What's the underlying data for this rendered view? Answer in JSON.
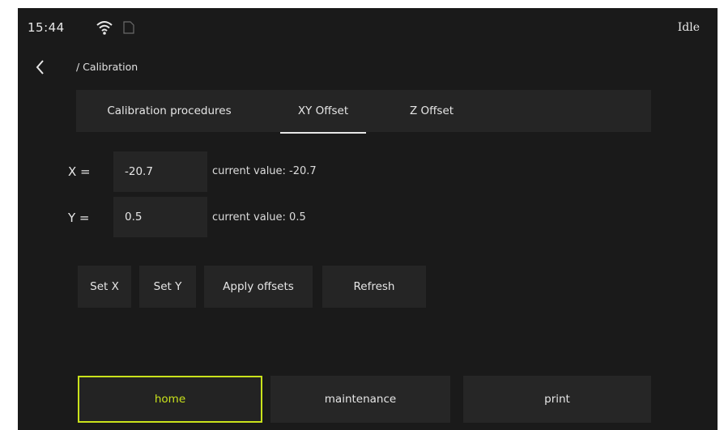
{
  "status_bar": {
    "time": "15:44",
    "wifi_icon": "wifi-icon",
    "sd_icon": "sd-card-icon",
    "state": "Idle"
  },
  "header": {
    "back_icon": "chevron-left-icon",
    "breadcrumb": "/ Calibration"
  },
  "tabs": [
    {
      "label": "Calibration procedures",
      "active": false
    },
    {
      "label": "XY Offset",
      "active": true
    },
    {
      "label": "Z Offset",
      "active": false
    }
  ],
  "offsets": {
    "x": {
      "label": "X =",
      "value": "-20.7",
      "current": "current value: -20.7"
    },
    "y": {
      "label": "Y =",
      "value": "0.5",
      "current": "current value: 0.5"
    }
  },
  "actions": {
    "set_x": "Set X",
    "set_y": "Set Y",
    "apply": "Apply offsets",
    "refresh": "Refresh"
  },
  "bottom_nav": {
    "home": "home",
    "maintenance": "maintenance",
    "print": "print"
  },
  "colors": {
    "background": "#1a1a1a",
    "panel": "#252525",
    "accent": "#c9e21b",
    "text": "#e6e6e6"
  }
}
